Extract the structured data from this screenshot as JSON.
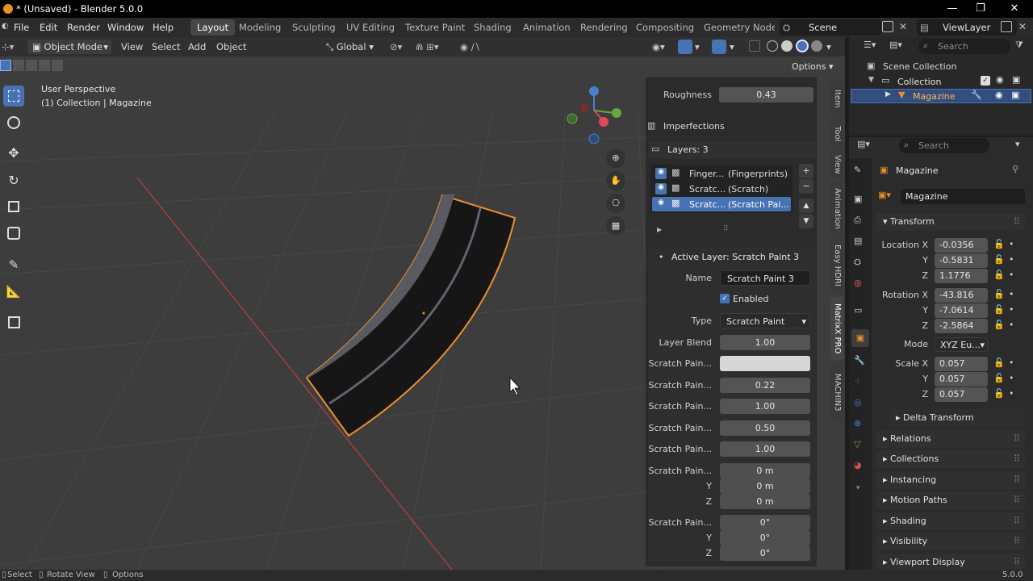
{
  "window": {
    "title": "* (Unsaved) - Blender 5.0.0"
  },
  "menu": [
    "File",
    "Edit",
    "Render",
    "Window",
    "Help"
  ],
  "workspaces": [
    "Layout",
    "Modeling",
    "Sculpting",
    "UV Editing",
    "Texture Paint",
    "Shading",
    "Animation",
    "Rendering",
    "Compositing",
    "Geometry Nodes"
  ],
  "scene": {
    "name": "Scene",
    "view_layer": "ViewLayer"
  },
  "vp_header": {
    "mode": "Object Mode",
    "view": "View",
    "select": "Select",
    "add": "Add",
    "object": "Object",
    "orientation": "Global",
    "options": "Options"
  },
  "viewport": {
    "line1": "User Perspective",
    "line2": "(1) Collection | Magazine"
  },
  "npanel": {
    "roughness_label": "Roughness",
    "roughness_value": "0.43",
    "imperfections": "Imperfections",
    "layers_title": "Layers: 3",
    "layers": [
      {
        "name": "Finger...",
        "type": "(Fingerprints)"
      },
      {
        "name": "Scratc...",
        "type": "(Scratch)"
      },
      {
        "name": "Scratc...",
        "type": "(Scratch Pai..."
      }
    ],
    "active_layer": "Active Layer: Scratch Paint 3",
    "name_label": "Name",
    "name_value": "Scratch Paint 3",
    "enabled": "Enabled",
    "type_label": "Type",
    "type_value": "Scratch Paint",
    "blend_label": "Layer Blend",
    "blend_value": "1.00",
    "sp": "Scratch Pain...",
    "sp_values": [
      "0.22",
      "1.00",
      "0.50",
      "1.00"
    ],
    "loc": [
      "0 m",
      "0 m",
      "0 m"
    ],
    "rot": [
      "0°",
      "0°",
      "0°"
    ],
    "y": "Y",
    "z": "Z"
  },
  "tabs": [
    "Item",
    "Tool",
    "View",
    "Animation",
    "Easy HDRI",
    "MatrixX PRO",
    "MACHIN3"
  ],
  "outliner": {
    "search": "Search",
    "scene_collection": "Scene Collection",
    "collection": "Collection",
    "object": "Magazine"
  },
  "props": {
    "search": "Search",
    "object": "Magazine",
    "data_name": "Magazine",
    "transform": "Transform",
    "location_label": "Location X",
    "location": [
      "-0.0356",
      "-0.5831",
      "1.1776"
    ],
    "rotation_label": "Rotation X",
    "rotation": [
      "-43.816",
      "-7.0614",
      "-2.5864"
    ],
    "mode_label": "Mode",
    "mode": "XYZ Eu...",
    "scale_label": "Scale X",
    "scale": [
      "0.057",
      "0.057",
      "0.057"
    ],
    "y": "Y",
    "z": "Z",
    "sections": [
      "Delta Transform",
      "Relations",
      "Collections",
      "Instancing",
      "Motion Paths",
      "Shading",
      "Visibility",
      "Viewport Display"
    ]
  },
  "status": {
    "select": "Select",
    "rotate": "Rotate View",
    "options": "Options",
    "version": "5.0.0"
  },
  "colors": {
    "accent": "#4772b3",
    "selection": "#e8902a",
    "x_axis": "#c64d4d"
  }
}
